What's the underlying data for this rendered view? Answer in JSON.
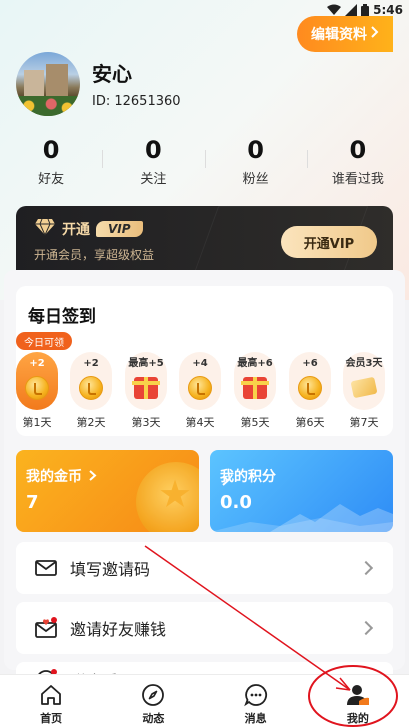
{
  "status_bar": {
    "time": "5:46"
  },
  "profile": {
    "name": "安心",
    "id_text": "ID: 12651360",
    "edit_label": "编辑资料"
  },
  "stats": [
    {
      "value": "0",
      "label": "好友"
    },
    {
      "value": "0",
      "label": "关注"
    },
    {
      "value": "0",
      "label": "粉丝"
    },
    {
      "value": "0",
      "label": "谁看过我"
    }
  ],
  "vip": {
    "open_label": "开通",
    "badge": "VIP",
    "subtitle": "开通会员，享超级权益",
    "button": "开通VIP"
  },
  "checkin": {
    "title": "每日签到",
    "today_tag": "今日可领",
    "days": [
      {
        "reward": "+2",
        "label": "第1天",
        "icon": "coin"
      },
      {
        "reward": "+2",
        "label": "第2天",
        "icon": "coin"
      },
      {
        "reward": "最高+5",
        "label": "第3天",
        "icon": "gift"
      },
      {
        "reward": "+4",
        "label": "第4天",
        "icon": "coin"
      },
      {
        "reward": "最高+6",
        "label": "第5天",
        "icon": "gift"
      },
      {
        "reward": "+6",
        "label": "第6天",
        "icon": "coin"
      },
      {
        "reward": "会员3天",
        "label": "第7天",
        "icon": "vip-card"
      }
    ]
  },
  "wallet": {
    "coins_label": "我的金币",
    "coins_value": "7",
    "points_label": "我的积分",
    "points_value": "0.0"
  },
  "menu": {
    "invite_code": "填写邀请码",
    "invite_friends": "邀请好友赚钱",
    "third_partial": "联合乐"
  },
  "tabs": [
    {
      "label": "首页",
      "icon": "home-icon"
    },
    {
      "label": "动态",
      "icon": "compass-icon"
    },
    {
      "label": "消息",
      "icon": "message-icon"
    },
    {
      "label": "我的",
      "icon": "profile-icon"
    }
  ],
  "colors": {
    "accent_orange": "#f27a1c",
    "vip_gold": "#f0c98a",
    "points_blue": "#2e8cf6",
    "annotation_red": "#e0141e"
  }
}
